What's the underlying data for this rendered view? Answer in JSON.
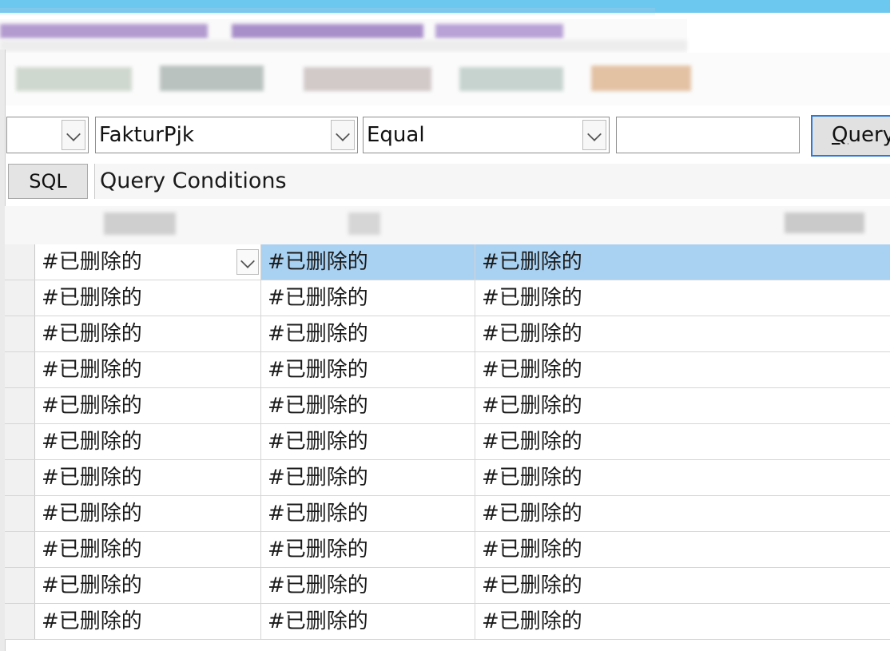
{
  "filter_bar": {
    "column_select": {
      "value": ""
    },
    "field_select": {
      "value": "FakturPjk"
    },
    "operator_select": {
      "value": "Equal"
    },
    "value_input": {
      "value": ""
    },
    "query_button": {
      "label_underlined": "Q",
      "label_rest": "uery"
    }
  },
  "conditions_bar": {
    "sql_button_label": "SQL",
    "conditions_label": "Query Conditions"
  },
  "grid": {
    "rows": [
      [
        "#已删除的",
        "#已删除的",
        "#已删除的"
      ],
      [
        "#已删除的",
        "#已删除的",
        "#已删除的"
      ],
      [
        "#已删除的",
        "#已删除的",
        "#已删除的"
      ],
      [
        "#已删除的",
        "#已删除的",
        "#已删除的"
      ],
      [
        "#已删除的",
        "#已删除的",
        "#已删除的"
      ],
      [
        "#已删除的",
        "#已删除的",
        "#已删除的"
      ],
      [
        "#已删除的",
        "#已删除的",
        "#已删除的"
      ],
      [
        "#已删除的",
        "#已删除的",
        "#已删除的"
      ],
      [
        "#已删除的",
        "#已删除的",
        "#已删除的"
      ],
      [
        "#已删除的",
        "#已删除的",
        "#已删除的"
      ],
      [
        "#已删除的",
        "#已删除的",
        "#已删除的"
      ]
    ],
    "selected_row": 0
  },
  "colors": {
    "selection": "#a9d1f2",
    "focus_border": "#2b79d8",
    "top_band": "#6cc8ef"
  }
}
